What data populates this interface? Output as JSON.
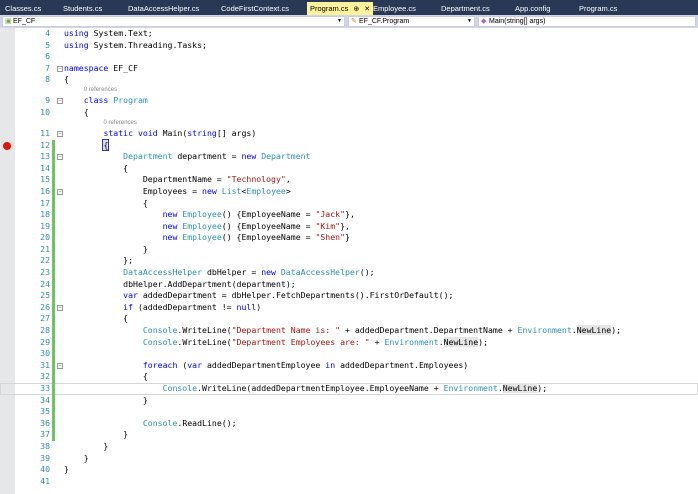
{
  "tabs": [
    {
      "label": "Classes.cs"
    },
    {
      "label": "Students.cs"
    },
    {
      "label": "DataAccessHelper.cs"
    },
    {
      "label": "CodeFirstContext.cs"
    },
    {
      "label": "Program.cs",
      "active": true
    },
    {
      "label": "Employee.cs"
    },
    {
      "label": "Department.cs"
    },
    {
      "label": "App.config"
    },
    {
      "label": "Program.cs"
    }
  ],
  "tab_pin": "⊕",
  "tab_close": "✕",
  "nav": {
    "project": "EF_CF",
    "type": "EF_CF.Program",
    "member": "Main(string[] args)"
  },
  "breakpoint_line": 12,
  "current_line": 33,
  "changed_lines": [
    12,
    37
  ],
  "lines": [
    {
      "n": "4",
      "t": [
        [
          "using",
          "k"
        ],
        [
          " System.Text;",
          ""
        ]
      ]
    },
    {
      "n": "5",
      "t": [
        [
          "using",
          "k"
        ],
        [
          " System.Threading.Tasks;",
          ""
        ]
      ]
    },
    {
      "n": "6",
      "t": []
    },
    {
      "n": "7",
      "f": 1,
      "t": [
        [
          "namespace",
          "k"
        ],
        [
          " EF_CF",
          ""
        ]
      ]
    },
    {
      "n": "8",
      "t": [
        [
          "{",
          ""
        ]
      ]
    },
    {
      "ref": "0 references",
      "i": 4
    },
    {
      "n": "9",
      "f": 1,
      "t": [
        [
          "    ",
          ""
        ],
        [
          "class",
          "k"
        ],
        [
          " ",
          ""
        ],
        [
          "Program",
          "t"
        ]
      ]
    },
    {
      "n": "10",
      "t": [
        [
          "    {",
          ""
        ]
      ]
    },
    {
      "ref": "0 references",
      "i": 8
    },
    {
      "n": "11",
      "f": 1,
      "t": [
        [
          "        ",
          ""
        ],
        [
          "static",
          "k"
        ],
        [
          " ",
          ""
        ],
        [
          "void",
          "k"
        ],
        [
          " Main(",
          ""
        ],
        [
          "string",
          "k"
        ],
        [
          "[] args)",
          ""
        ]
      ]
    },
    {
      "n": "12",
      "t": [
        [
          "        ",
          ""
        ],
        [
          "{",
          "b"
        ]
      ]
    },
    {
      "n": "13",
      "f": 1,
      "t": [
        [
          "            ",
          ""
        ],
        [
          "Department",
          "t"
        ],
        [
          " department = ",
          ""
        ],
        [
          "new",
          "k"
        ],
        [
          " ",
          ""
        ],
        [
          "Department",
          "t"
        ]
      ]
    },
    {
      "n": "14",
      "t": [
        [
          "            {",
          ""
        ]
      ]
    },
    {
      "n": "15",
      "t": [
        [
          "                DepartmentName = ",
          ""
        ],
        [
          "\"Technology\"",
          "s"
        ],
        [
          ",",
          ""
        ]
      ]
    },
    {
      "n": "16",
      "f": 1,
      "t": [
        [
          "                Employees = ",
          ""
        ],
        [
          "new",
          "k"
        ],
        [
          " ",
          ""
        ],
        [
          "List",
          "t"
        ],
        [
          "<",
          ""
        ],
        [
          "Employee",
          "t"
        ],
        [
          ">",
          ""
        ]
      ]
    },
    {
      "n": "17",
      "t": [
        [
          "                {",
          ""
        ]
      ]
    },
    {
      "n": "18",
      "t": [
        [
          "                    ",
          ""
        ],
        [
          "new",
          "k"
        ],
        [
          " ",
          ""
        ],
        [
          "Employee",
          "t"
        ],
        [
          "() {EmployeeName = ",
          ""
        ],
        [
          "\"Jack\"",
          "s"
        ],
        [
          "},",
          ""
        ]
      ]
    },
    {
      "n": "19",
      "t": [
        [
          "                    ",
          ""
        ],
        [
          "new",
          "k"
        ],
        [
          " ",
          ""
        ],
        [
          "Employee",
          "t"
        ],
        [
          "() {EmployeeName = ",
          ""
        ],
        [
          "\"Kim\"",
          "s"
        ],
        [
          "},",
          ""
        ]
      ]
    },
    {
      "n": "20",
      "t": [
        [
          "                    ",
          ""
        ],
        [
          "new",
          "k"
        ],
        [
          " ",
          ""
        ],
        [
          "Employee",
          "t"
        ],
        [
          "() {EmployeeName = ",
          ""
        ],
        [
          "\"Shen\"",
          "s"
        ],
        [
          "}",
          ""
        ]
      ]
    },
    {
      "n": "21",
      "t": [
        [
          "                }",
          ""
        ]
      ]
    },
    {
      "n": "22",
      "t": [
        [
          "            };",
          ""
        ]
      ]
    },
    {
      "n": "23",
      "t": [
        [
          "            ",
          ""
        ],
        [
          "DataAccessHelper",
          "t"
        ],
        [
          " dbHelper = ",
          ""
        ],
        [
          "new",
          "k"
        ],
        [
          " ",
          ""
        ],
        [
          "DataAccessHelper",
          "t"
        ],
        [
          "();",
          ""
        ]
      ]
    },
    {
      "n": "24",
      "t": [
        [
          "            dbHelper.AddDepartment(department);",
          ""
        ]
      ]
    },
    {
      "n": "25",
      "t": [
        [
          "            ",
          ""
        ],
        [
          "var",
          "k"
        ],
        [
          " addedDepartment = dbHelper.FetchDepartments().FirstOrDefault();",
          ""
        ]
      ]
    },
    {
      "n": "26",
      "f": 1,
      "t": [
        [
          "            ",
          ""
        ],
        [
          "if",
          "k"
        ],
        [
          " (addedDepartment != ",
          ""
        ],
        [
          "null",
          "k"
        ],
        [
          ")",
          ""
        ]
      ]
    },
    {
      "n": "27",
      "t": [
        [
          "            {",
          ""
        ]
      ]
    },
    {
      "n": "28",
      "t": [
        [
          "                ",
          ""
        ],
        [
          "Console",
          "t"
        ],
        [
          ".WriteLine(",
          ""
        ],
        [
          "\"Department Name is: \"",
          "s"
        ],
        [
          " + addedDepartment.DepartmentName + ",
          ""
        ],
        [
          "Environment",
          "t"
        ],
        [
          ".",
          ""
        ],
        [
          "NewLine",
          "h"
        ],
        [
          ");",
          ""
        ]
      ]
    },
    {
      "n": "29",
      "t": [
        [
          "                ",
          ""
        ],
        [
          "Console",
          "t"
        ],
        [
          ".WriteLine(",
          ""
        ],
        [
          "\"Department Employees are: \"",
          "s"
        ],
        [
          " + ",
          ""
        ],
        [
          "Environment",
          "t"
        ],
        [
          ".",
          ""
        ],
        [
          "NewLine",
          "h"
        ],
        [
          ");",
          ""
        ]
      ]
    },
    {
      "n": "30",
      "t": []
    },
    {
      "n": "31",
      "f": 1,
      "t": [
        [
          "                ",
          ""
        ],
        [
          "foreach",
          "k"
        ],
        [
          " (",
          ""
        ],
        [
          "var",
          "k"
        ],
        [
          " addedDepartmentEmployee ",
          ""
        ],
        [
          "in",
          "k"
        ],
        [
          " addedDepartment.Employees)",
          ""
        ]
      ]
    },
    {
      "n": "32",
      "t": [
        [
          "                {",
          ""
        ]
      ]
    },
    {
      "n": "33",
      "t": [
        [
          "                    ",
          ""
        ],
        [
          "Console",
          "t"
        ],
        [
          ".WriteLine(addedDepartmentEmployee.EmployeeName + ",
          ""
        ],
        [
          "Environment",
          "t"
        ],
        [
          ".",
          ""
        ],
        [
          "NewLine",
          "h"
        ],
        [
          ");",
          ""
        ]
      ]
    },
    {
      "n": "34",
      "t": [
        [
          "                }",
          ""
        ]
      ]
    },
    {
      "n": "35",
      "t": []
    },
    {
      "n": "36",
      "t": [
        [
          "                ",
          ""
        ],
        [
          "Console",
          "t"
        ],
        [
          ".ReadLine();",
          ""
        ]
      ]
    },
    {
      "n": "37",
      "t": [
        [
          "            }",
          ""
        ]
      ]
    },
    {
      "n": "38",
      "t": [
        [
          "        }",
          ""
        ]
      ]
    },
    {
      "n": "39",
      "t": [
        [
          "    }",
          ""
        ]
      ]
    },
    {
      "n": "40",
      "t": [
        [
          "}",
          ""
        ]
      ]
    },
    {
      "n": "41",
      "t": []
    }
  ]
}
